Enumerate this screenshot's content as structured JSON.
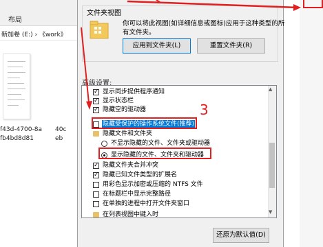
{
  "explorer": {
    "ribbon_tab": "布局",
    "path_text": "新加卷 (E:)  ›  《work》",
    "files": [
      "f43d-4700-8a",
      "fb4bd8d81",
      "40c",
      "eb"
    ]
  },
  "dialog": {
    "folder_views": {
      "title": "文件夹视图",
      "desc_line1": "你可以将此视图(如详细信息或图标)应用于这种类型的所",
      "desc_line2": "有文件夹。",
      "apply_label": "应用到文件夹(L)",
      "reset_label": "重置文件夹(R)"
    },
    "advanced_label": "高级设置:",
    "settings": [
      {
        "type": "checkbox",
        "checked": true,
        "label": "显示同步提供程序通知"
      },
      {
        "type": "checkbox",
        "checked": true,
        "label": "显示状态栏"
      },
      {
        "type": "checkbox",
        "checked": true,
        "label": "隐藏空的驱动器"
      },
      {
        "type": "checkbox",
        "checked": false,
        "label": "隐藏受保护的操作系统文件(推荐)"
      },
      {
        "type": "folder",
        "label": "隐藏文件和文件夹"
      },
      {
        "type": "radio",
        "selected": false,
        "label": "不显示隐藏的文件、文件夹或驱动器"
      },
      {
        "type": "radio",
        "selected": true,
        "label": "显示隐藏的文件、文件夹和驱动器"
      },
      {
        "type": "checkbox",
        "checked": true,
        "label": "隐藏文件夹合并冲突"
      },
      {
        "type": "checkbox",
        "checked": true,
        "label": "隐藏已知文件类型的扩展名"
      },
      {
        "type": "checkbox",
        "checked": false,
        "label": "用彩色显示加密或压缩的 NTFS 文件"
      },
      {
        "type": "checkbox",
        "checked": false,
        "label": "在标题栏中显示完整路径"
      },
      {
        "type": "checkbox",
        "checked": false,
        "label": "在单独的进程中打开文件夹窗口"
      },
      {
        "type": "folder",
        "label": "在列表视图中键入时"
      }
    ],
    "restore_label": "还原为默认值(D)"
  },
  "annotation": {
    "step_number": "3",
    "color": "#e02020"
  }
}
